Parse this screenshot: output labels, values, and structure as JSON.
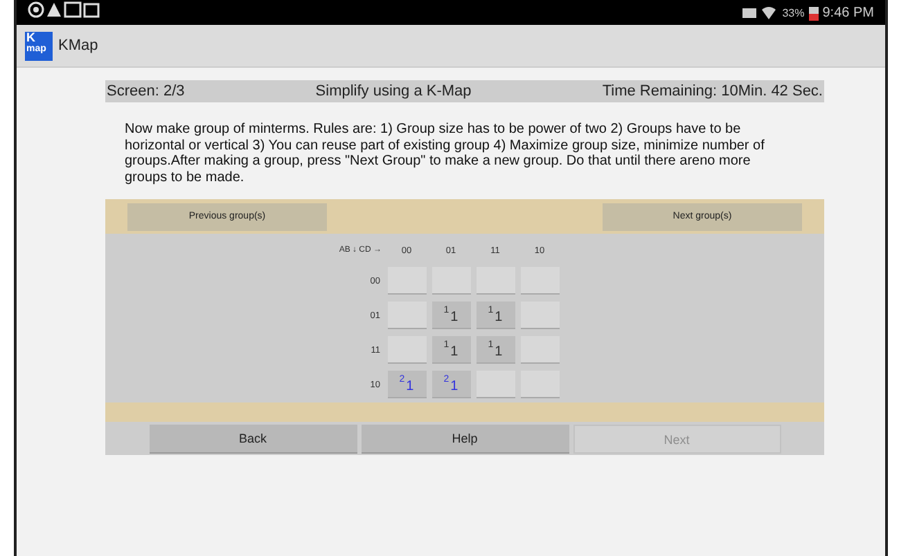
{
  "status_bar": {
    "battery": "33%",
    "time": "9:46 PM"
  },
  "app_bar": {
    "title": "KMap",
    "logo_text": "K",
    "logo_sub": "map"
  },
  "header": {
    "screen": "Screen: 2/3",
    "title": "Simplify using a K-Map",
    "time_remaining": "Time Remaining: 10Min. 42 Sec."
  },
  "instructions": "Now make group of minterms. Rules are: 1) Group size has to be power of two 2) Groups have to be horizontal or vertical 3) You can reuse part of existing group 4) Maximize group size, minimize number of groups.After making a group, press \"Next Group\" to make a new group. Do that until there areno more groups to be made.",
  "group_buttons": [
    {
      "label": "Previous group(s)"
    },
    {
      "label": "Next group(s)"
    }
  ],
  "kmap": {
    "axis_label": "AB ↓ CD →",
    "columns": [
      "00",
      "01",
      "11",
      "10"
    ],
    "rows": [
      {
        "label": "00",
        "cells": [
          {
            "selected": false
          },
          {
            "selected": false
          },
          {
            "selected": false
          },
          {
            "selected": false
          }
        ]
      },
      {
        "label": "01",
        "cells": [
          {
            "selected": false
          },
          {
            "selected": true,
            "group": "1",
            "value": "1",
            "color": "#333333"
          },
          {
            "selected": true,
            "group": "1",
            "value": "1",
            "color": "#333333"
          },
          {
            "selected": false
          }
        ]
      },
      {
        "label": "11",
        "cells": [
          {
            "selected": false
          },
          {
            "selected": true,
            "group": "1",
            "value": "1",
            "color": "#333333"
          },
          {
            "selected": true,
            "group": "1",
            "value": "1",
            "color": "#333333"
          },
          {
            "selected": false
          }
        ]
      },
      {
        "label": "10",
        "cells": [
          {
            "selected": true,
            "group": "2",
            "value": "1",
            "color": "#3333dd"
          },
          {
            "selected": true,
            "group": "2",
            "value": "1",
            "color": "#3333dd"
          },
          {
            "selected": false
          },
          {
            "selected": false
          }
        ]
      }
    ]
  },
  "nav_buttons": [
    {
      "label": "Back",
      "disabled": false
    },
    {
      "label": "Help",
      "disabled": false
    },
    {
      "label": "Next",
      "disabled": true
    }
  ]
}
